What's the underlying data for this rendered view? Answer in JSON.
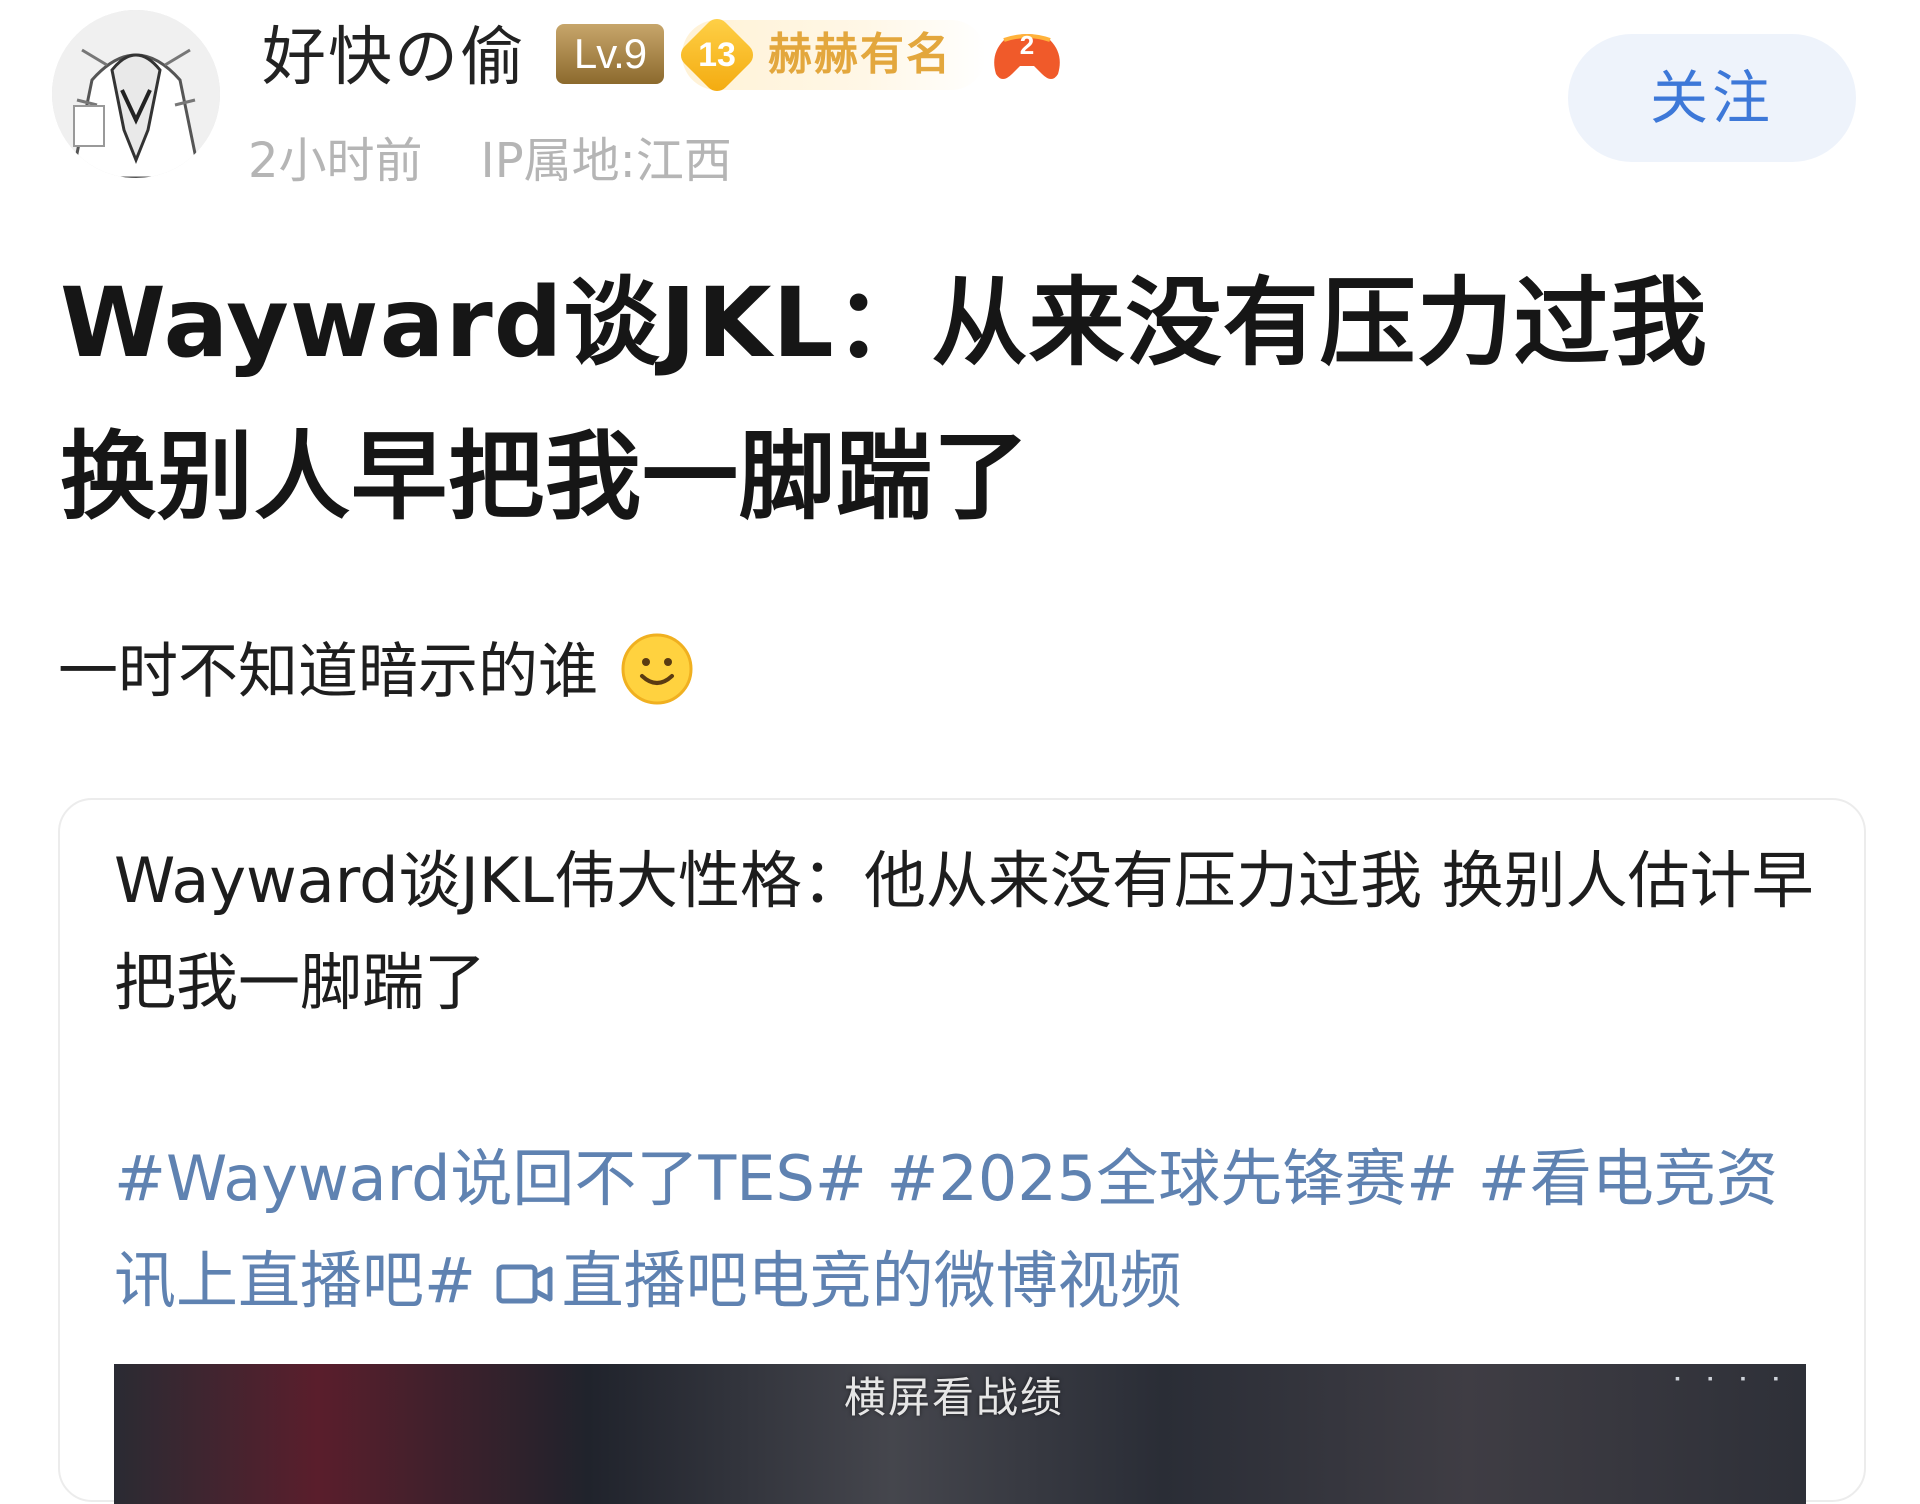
{
  "author": {
    "name": "好快の偷",
    "level": "Lv.9",
    "fan_badge": {
      "number": "13",
      "title": "赫赫有名"
    },
    "game_badge_number": "2",
    "time": "2小时前",
    "ip_location": "IP属地:江西"
  },
  "actions": {
    "follow_label": "关注"
  },
  "post": {
    "title_line1": "Wayward谈JKL：从来没有压力过我",
    "title_line2": "换别人早把我一脚踹了",
    "body": "一时不知道暗示的谁"
  },
  "repost": {
    "text": "Wayward谈JKL伟大性格：他从来没有压力过我 换别人估计早把我一脚踹了",
    "tags": "#Wayward说回不了TES# #2025全球先锋赛# #看电竞资讯上直播吧#",
    "video_link_label": "直播吧电竞的微博视频",
    "video_overlay": "横屏看战绩"
  },
  "colors": {
    "accent_blue": "#3d78d8",
    "tag_blue": "#5f82b1",
    "meta_gray": "#b5b5b5",
    "level_gold": "#a8874a",
    "fan_gold": "#e3a73d"
  }
}
